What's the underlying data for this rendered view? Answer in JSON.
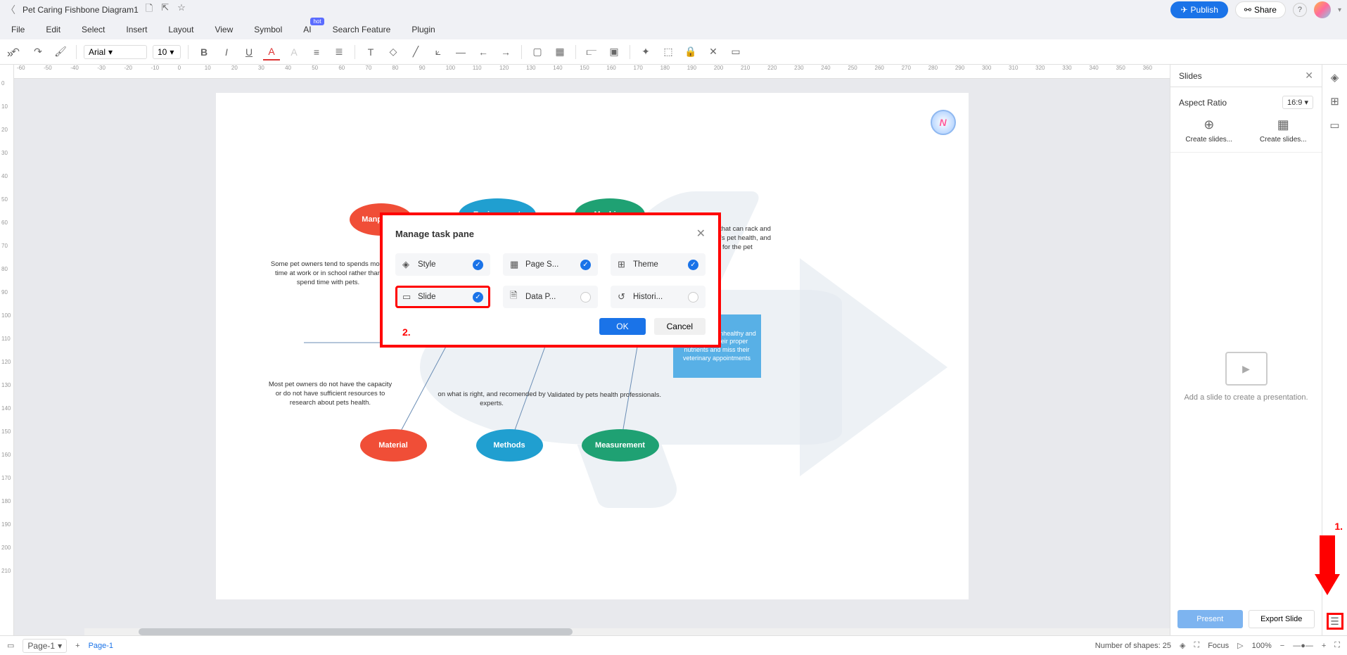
{
  "title": "Pet Caring Fishbone Diagram1",
  "header": {
    "publish": "Publish",
    "share": "Share"
  },
  "menu": {
    "file": "File",
    "edit": "Edit",
    "select": "Select",
    "insert": "Insert",
    "layout": "Layout",
    "view": "View",
    "symbol": "Symbol",
    "ai": "AI",
    "ai_badge": "hot",
    "search": "Search Feature",
    "plugin": "Plugin"
  },
  "toolbar": {
    "font": "Arial",
    "size": "10"
  },
  "ruler_h": [
    "-60",
    "-50",
    "-40",
    "-30",
    "-20",
    "-10",
    "0",
    "10",
    "20",
    "30",
    "40",
    "50",
    "60",
    "70",
    "80",
    "90",
    "100",
    "110",
    "120",
    "130",
    "140",
    "150",
    "160",
    "170",
    "180",
    "190",
    "200",
    "210",
    "220",
    "230",
    "240",
    "250",
    "260",
    "270",
    "280",
    "290",
    "300",
    "310",
    "320",
    "330",
    "340",
    "350",
    "360"
  ],
  "ruler_v": [
    "0",
    "10",
    "20",
    "30",
    "40",
    "50",
    "60",
    "70",
    "80",
    "90",
    "100",
    "110",
    "120",
    "130",
    "140",
    "150",
    "160",
    "170",
    "180",
    "190",
    "200",
    "210"
  ],
  "fishbone": {
    "manpower": "Manpower",
    "environment": "Environment",
    "machine": "Machine",
    "material": "Material",
    "methods": "Methods",
    "measurement": "Measurement",
    "t1": "Some pet owners tend to spends more time at work or in school rather than spend time with pets.",
    "t2": "Most pet owners do not have the capacity or do not have sufficient resources to research about pets health.",
    "t3": "on what is right, and recomended by experts.",
    "t4": "Validated by pets health professionals.",
    "t5": "ack of application that can rack and monitor the app er's pet health, and suggest diet for the pet",
    "result": "Pets become unhealthy and do not get their proper nutrients and miss their veterinary appointments"
  },
  "modal": {
    "title": "Manage task pane",
    "items": [
      {
        "label": "Style",
        "checked": true,
        "icon": "◈"
      },
      {
        "label": "Page S...",
        "checked": true,
        "icon": "▦"
      },
      {
        "label": "Theme",
        "checked": true,
        "icon": "⊞"
      },
      {
        "label": "Slide",
        "checked": true,
        "icon": "▭",
        "highlighted": true
      },
      {
        "label": "Data P...",
        "checked": false,
        "icon": "🗎"
      },
      {
        "label": "Histori...",
        "checked": false,
        "icon": "↺"
      }
    ],
    "ok": "OK",
    "cancel": "Cancel",
    "annot2": "2."
  },
  "right_panel": {
    "title": "Slides",
    "aspect_label": "Aspect Ratio",
    "aspect_value": "16:9",
    "create1": "Create slides...",
    "create2": "Create slides...",
    "placeholder": "Add a slide to create a presentation.",
    "present": "Present",
    "export": "Export Slide"
  },
  "annotations": {
    "label1": "1."
  },
  "bottom": {
    "page_sel": "Page-1",
    "page_tab": "Page-1",
    "shapes": "Number of shapes: 25",
    "focus": "Focus",
    "zoom": "100%"
  }
}
